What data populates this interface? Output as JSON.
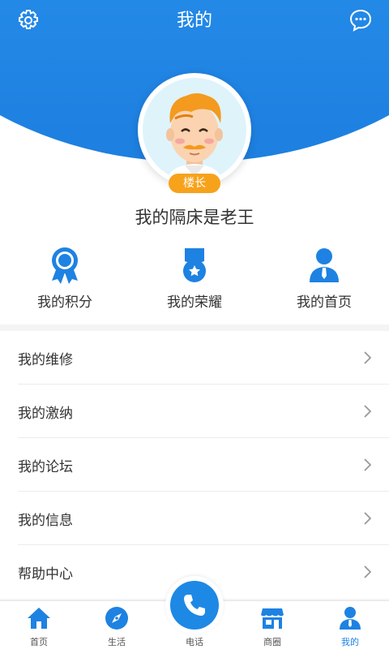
{
  "header": {
    "title": "我的",
    "settings_icon": "gear-icon",
    "message_icon": "chat-bubble-icon"
  },
  "profile": {
    "badge": "楼长",
    "username": "我的隔床是老王"
  },
  "features": [
    {
      "label": "我的积分",
      "icon": "ribbon-award-icon"
    },
    {
      "label": "我的荣耀",
      "icon": "medal-icon"
    },
    {
      "label": "我的首页",
      "icon": "user-profile-icon"
    }
  ],
  "menu": [
    {
      "label": "我的维修"
    },
    {
      "label": "我的激纳"
    },
    {
      "label": "我的论坛"
    },
    {
      "label": "我的信息"
    },
    {
      "label": "帮助中心"
    }
  ],
  "tabs": [
    {
      "label": "首页",
      "icon": "home-icon"
    },
    {
      "label": "生活",
      "icon": "compass-icon"
    },
    {
      "label": "电话",
      "icon": "phone-icon"
    },
    {
      "label": "商圈",
      "icon": "store-icon"
    },
    {
      "label": "我的",
      "icon": "person-icon",
      "active": true
    }
  ],
  "colors": {
    "primary": "#1e82e2",
    "badge": "#f7a21b"
  }
}
